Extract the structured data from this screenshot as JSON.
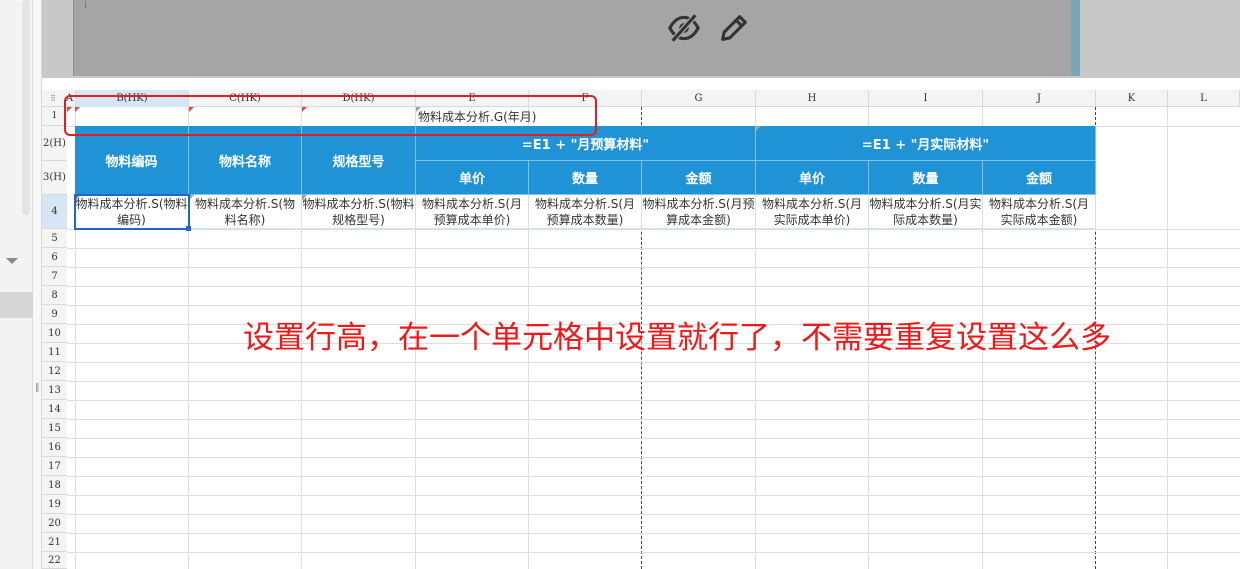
{
  "columns": [
    "A",
    "B(HK)",
    "C(HK)",
    "D(HK)",
    "E",
    "F",
    "G",
    "H",
    "I",
    "J",
    "K",
    "L"
  ],
  "rows": [
    "1",
    "2(H)",
    "3(H)",
    "4",
    "5",
    "6",
    "7",
    "8",
    "9",
    "10",
    "11",
    "12",
    "13",
    "14",
    "15",
    "16",
    "17",
    "18",
    "19",
    "20",
    "21",
    "22"
  ],
  "row1_formula": "物料成本分析.G(年月)",
  "header": {
    "code": "物料编码",
    "name": "物料名称",
    "spec": "规格型号",
    "budget_group": "=E1 + \"月预算材料\"",
    "actual_group": "=E1 + \"月实际材料\"",
    "unit_price": "单价",
    "quantity": "数量",
    "amount": "金额"
  },
  "row4": {
    "b": "物料成本分析.S(物料编码)",
    "c": "物料成本分析.S(物料名称)",
    "d": "物料成本分析.S(物料规格型号)",
    "e": "物料成本分析.S(月预算成本单价)",
    "f": "物料成本分析.S(月预算成本数量)",
    "g": "物料成本分析.S(月预算成本金额)",
    "h": "物料成本分析.S(月实际成本单价)",
    "i": "物料成本分析.S(月实际成本数量)",
    "j": "物料成本分析.S(月实际成本金额)"
  },
  "annotation": "设置行高，在一个单元格中设置就行了，不需要重复设置这么多",
  "icons": {
    "hide": "eye-slash-icon",
    "edit": "pencil-icon"
  },
  "colors": {
    "header_fill": "#1f93d6",
    "annotation": "#f01818",
    "selection": "#2266cc"
  }
}
